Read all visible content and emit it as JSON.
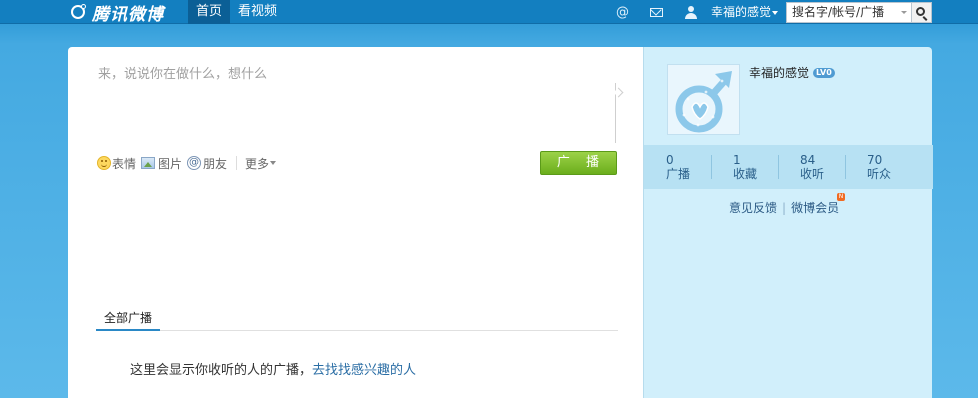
{
  "header": {
    "logo_text": "腾讯微博",
    "nav": [
      {
        "label": "首页",
        "active": true
      },
      {
        "label": "看视频",
        "active": false
      }
    ],
    "icons": [
      "at-icon",
      "mail-icon",
      "user-icon"
    ],
    "username": "幸福的感觉",
    "search": {
      "value": "搜名字/帐号/广播"
    }
  },
  "composer": {
    "placeholder": "来，说说你在做什么，想什么",
    "tools": {
      "emotion": "表情",
      "picture": "图片",
      "friend": "朋友",
      "more": "更多"
    },
    "submit_label": "广 播"
  },
  "feed": {
    "tab_label": "全部广播",
    "empty_text": "这里会显示你收听的人的广播，",
    "find_link": "去找找感兴趣的人"
  },
  "profile": {
    "name": "幸福的感觉",
    "level_badge": "LV0",
    "stats": [
      {
        "value": "0",
        "label": "广播"
      },
      {
        "value": "1",
        "label": "收藏"
      },
      {
        "value": "84",
        "label": "收听"
      },
      {
        "value": "70",
        "label": "听众"
      }
    ],
    "feedback_link": "意见反馈",
    "member_link": "微博会员",
    "new_badge": "N"
  },
  "colors": {
    "header_bg": "#137fc0",
    "page_bg": "#5cb9ea",
    "sidebar_bg": "#d1effb",
    "button_green": "#7cc030",
    "link": "#2b6ea5"
  }
}
